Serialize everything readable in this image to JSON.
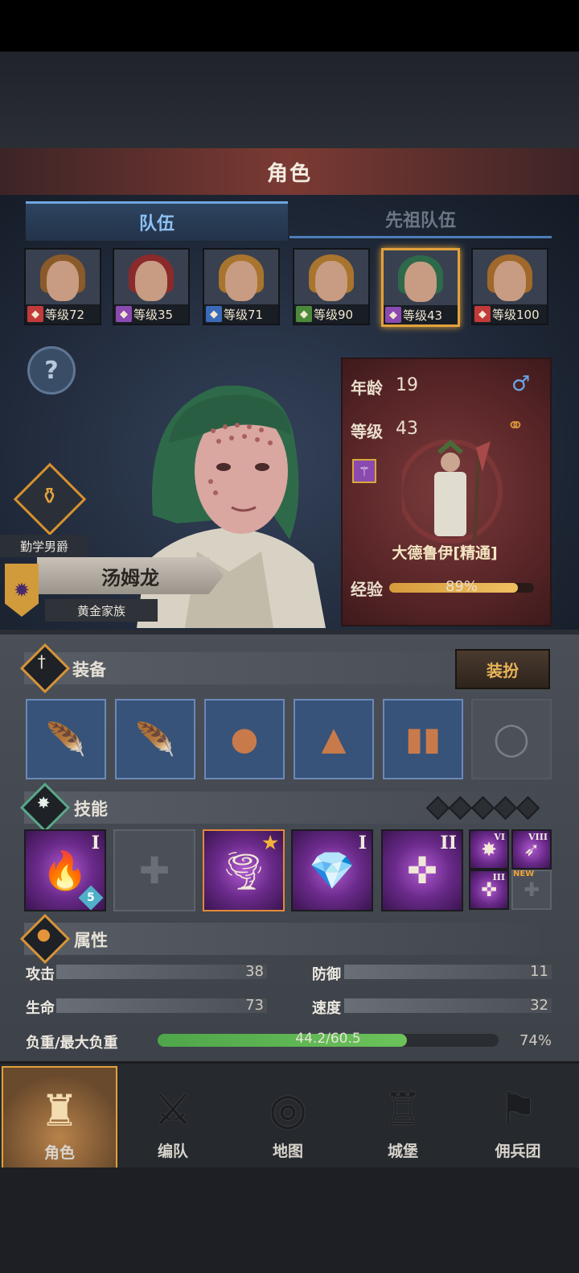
{
  "header": {
    "title": "角色"
  },
  "tabs": [
    {
      "label": "队伍",
      "active": true
    },
    {
      "label": "先祖队伍",
      "active": false
    }
  ],
  "party": [
    {
      "level_label": "等级72",
      "class_icon": "horse-icon",
      "class_color": "#c23a3a",
      "hair": "#8a5a2a",
      "selected": false
    },
    {
      "level_label": "等级35",
      "class_icon": "staff-icon",
      "class_color": "#8a4ab0",
      "hair": "#8a2a2a",
      "selected": false
    },
    {
      "level_label": "等级71",
      "class_icon": "sword-icon",
      "class_color": "#3a6ab8",
      "hair": "#a8742e",
      "selected": false
    },
    {
      "level_label": "等级90",
      "class_icon": "crossed-swords-icon",
      "class_color": "#4a8a3a",
      "hair": "#a8742e",
      "selected": false
    },
    {
      "level_label": "等级43",
      "class_icon": "staff-icon",
      "class_color": "#8a4ab0",
      "hair": "#2e6a4a",
      "selected": true
    },
    {
      "level_label": "等级100",
      "class_icon": "horse-icon",
      "class_color": "#c23a3a",
      "hair": "#a0682a",
      "selected": false
    }
  ],
  "character": {
    "title": "勤学男爵",
    "name": "汤姆龙",
    "family": "黄金家族",
    "age_label": "年龄",
    "age": "19",
    "level_label": "等级",
    "level": "43",
    "class_name": "大德鲁伊[精通]",
    "exp_label": "经验",
    "exp_percent_text": "89%",
    "exp_fraction": 0.89
  },
  "equipment": {
    "title": "装备",
    "outfit_button": "装扮",
    "slots": [
      {
        "name": "claw-weapon",
        "icon": "🪶",
        "empty": false
      },
      {
        "name": "claw-weapon",
        "icon": "🪶",
        "empty": false
      },
      {
        "name": "hood",
        "icon": "●",
        "empty": false
      },
      {
        "name": "robe",
        "icon": "▲",
        "empty": false
      },
      {
        "name": "boots",
        "icon": "▮▮",
        "empty": false
      },
      {
        "name": "ring",
        "icon": "◯",
        "empty": true
      }
    ]
  },
  "skills": {
    "title": "技能",
    "slots": [
      {
        "icon": "🔥",
        "rank": "I",
        "badge": "5",
        "empty": false
      },
      {
        "icon": "✚",
        "rank": "",
        "badge": "",
        "empty": true
      },
      {
        "icon": "🌪",
        "rank": "★",
        "badge": "",
        "empty": false,
        "gold": true
      },
      {
        "icon": "💎",
        "rank": "I",
        "badge": "",
        "empty": false
      },
      {
        "icon": "✜",
        "rank": "II",
        "badge": "",
        "empty": false
      }
    ],
    "minis": [
      {
        "rank": "VI",
        "icon": "✸"
      },
      {
        "rank": "VIII",
        "icon": "➶"
      },
      {
        "rank": "III",
        "icon": "✜"
      },
      {
        "rank": "",
        "icon": "✚",
        "new": "NEW"
      }
    ]
  },
  "attributes": {
    "title": "属性",
    "attack_label": "攻击",
    "attack": "38",
    "defense_label": "防御",
    "defense": "11",
    "hp_label": "生命",
    "hp": "73",
    "speed_label": "速度",
    "speed": "32",
    "load_label": "负重/最大负重",
    "load_text": "44.2/60.5",
    "load_percent": "74%",
    "load_fraction": 0.73
  },
  "nav": [
    {
      "label": "角色",
      "icon": "♜",
      "active": true
    },
    {
      "label": "编队",
      "icon": "⚔",
      "active": false
    },
    {
      "label": "地图",
      "icon": "◎",
      "active": false
    },
    {
      "label": "城堡",
      "icon": "♖",
      "active": false
    },
    {
      "label": "佣兵团",
      "icon": "⚑",
      "active": false
    }
  ]
}
